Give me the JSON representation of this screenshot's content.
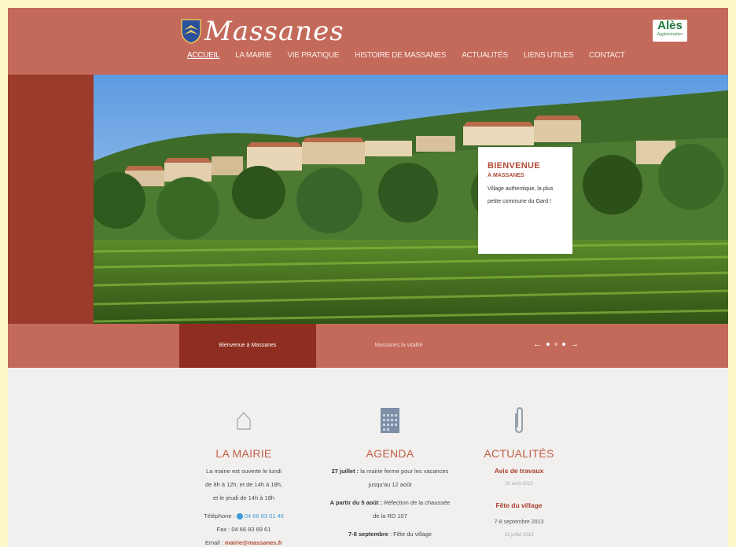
{
  "header": {
    "logo_text": "Massanes",
    "nav": [
      "ACCUEIL",
      "LA MAIRIE",
      "VIE PRATIQUE",
      "HISTOIRE DE MASSANES",
      "ACTUALITÉS",
      "LIENS UTILES",
      "CONTACT"
    ],
    "partner_logo": "Alès",
    "partner_sub": "Agglomération"
  },
  "hero": {
    "welcome_title": "BIENVENUE",
    "welcome_subtitle": "À MASSANES",
    "welcome_text": "Village authentique, la plus petite commune du Gard !"
  },
  "slider": {
    "tabs": [
      "Bienvenue à Massanes",
      "Massanes la vitalité"
    ],
    "prev": "←",
    "next": "→"
  },
  "mairie": {
    "title": "LA MAIRIE",
    "line1": "La mairie est ouverte le lundi",
    "line2": "de 8h à 12h, et de 14h à 18h,",
    "line3": "et le jeudi de 14h à 18h",
    "phone_label": "Téléphone :",
    "phone": "04 66 83 01 46",
    "fax": "Fax : 04 66 83 69 61",
    "email_label": "Email :",
    "email": "mairie@massanes.fr"
  },
  "agenda": {
    "title": "AGENDA",
    "item1_date": "27 juillet :",
    "item1_text": "la mairie ferme pour les vacances",
    "item1_text2": "jusqu'au 12 août",
    "item2_date": "A partir du 5 août :",
    "item2_text": "Réfection de la chaussée",
    "item2_text2": "de la RD 107",
    "item3_date": "7-8 septembre",
    "item3_text": ": Fête du village"
  },
  "actualites": {
    "title": "ACTUALITÉS",
    "news1_title": "Avis de travaux",
    "news1_date": "01 août 2013",
    "news2_title": "Fête du village",
    "news2_sub": "7-8 septembre 2013",
    "news2_date": "19 juillet 2013"
  },
  "colors": {
    "header": "#c46a5b",
    "dark_red": "#9b3b2b",
    "accent": "#c25d47"
  }
}
